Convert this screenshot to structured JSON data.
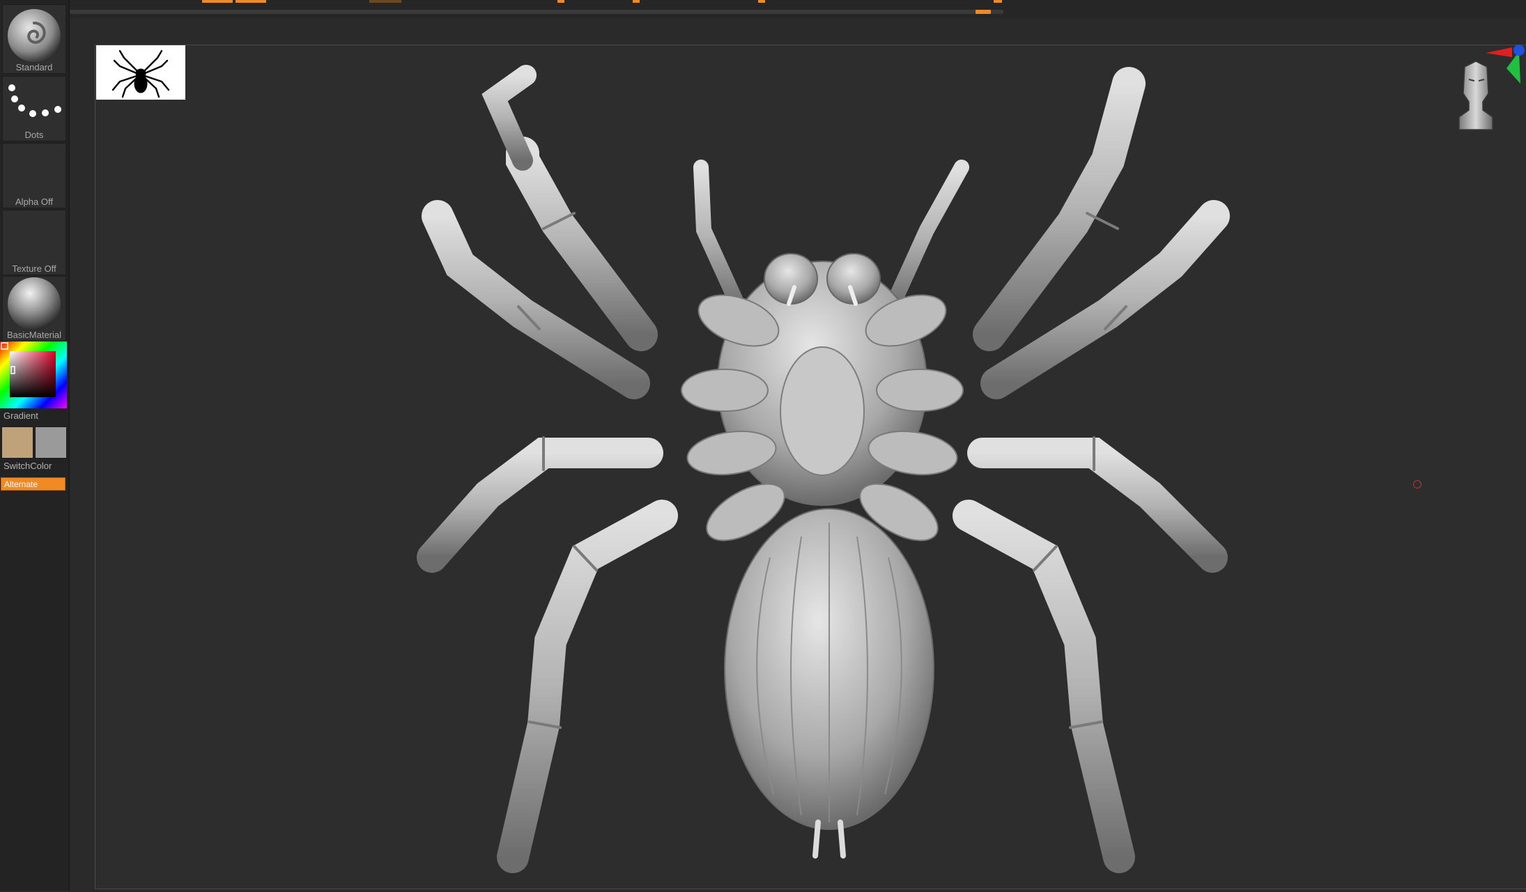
{
  "left_tray": {
    "brush": {
      "label": "Standard",
      "icon": "standard-brush-icon"
    },
    "stroke": {
      "label": "Dots",
      "icon": "dots-stroke-icon"
    },
    "alpha": {
      "label": "Alpha Off"
    },
    "texture": {
      "label": "Texture Off"
    },
    "material": {
      "label": "BasicMaterial",
      "icon": "material-sphere-icon"
    },
    "color": {
      "picker_icon": "color-picker-icon",
      "gradient_label": "Gradient",
      "main_color": "#c0a27a",
      "secondary_color": "#9a9a9a",
      "switch_label": "SwitchColor",
      "alternate_label": "Alternate"
    }
  },
  "canvas": {
    "reference_icon": "spider-silhouette-icon",
    "model_icon": "spider-sculpt-model",
    "navigation_icon": "head-navigation-gizmo-icon",
    "axis_icon": "xyz-axis-icon",
    "cursor_icon": "brush-cursor-icon"
  },
  "colors": {
    "accent": "#f08a24",
    "background": "#2d2d2d",
    "tray": "#232323"
  }
}
